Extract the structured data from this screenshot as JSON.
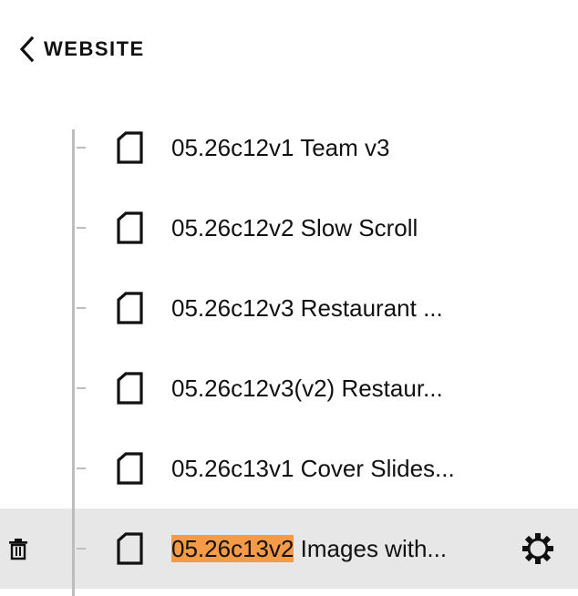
{
  "header": {
    "back_icon": "chevron-left-icon",
    "title": "WEBSITE"
  },
  "pages": [
    {
      "title": "05.26c12v1 Team v3",
      "icon": "page-icon"
    },
    {
      "title": "05.26c12v2 Slow Scroll",
      "icon": "page-icon"
    },
    {
      "title": "05.26c12v3 Restaurant ...",
      "icon": "page-icon"
    },
    {
      "title": "05.26c12v3(v2) Restaur...",
      "icon": "page-icon"
    },
    {
      "title": "05.26c13v1 Cover Slides...",
      "icon": "page-icon"
    },
    {
      "title_highlight": "05.26c13v2",
      "title_rest": " Images with...",
      "icon": "page-icon",
      "selected": true,
      "delete_icon": "trash-icon",
      "settings_icon": "gear-icon"
    }
  ],
  "colors": {
    "highlight": "#f59a46",
    "selected_row_bg": "#e7e7e7",
    "tree_line": "#bdbdbd"
  }
}
